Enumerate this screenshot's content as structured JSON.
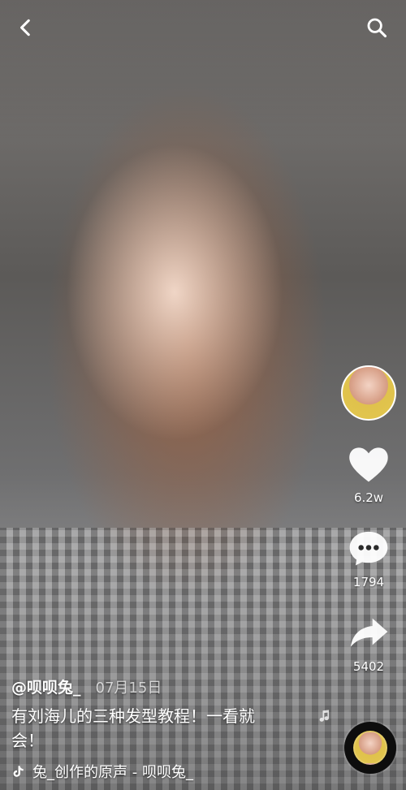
{
  "icons": {
    "back": "chevron-left-icon",
    "search": "search-icon",
    "like": "heart-icon",
    "comment": "comment-bubble-icon",
    "share": "share-arrow-icon",
    "music": "tiktok-note-icon"
  },
  "actions": {
    "likes": "6.2w",
    "comments": "1794",
    "shares": "5402"
  },
  "post": {
    "username": "@呗呗兔_",
    "date": "07月15日",
    "description_line1": "有刘海儿的三种发型教程！一看就",
    "description_line2": "会！",
    "music": "兔_创作的原声 - 呗呗兔_"
  }
}
